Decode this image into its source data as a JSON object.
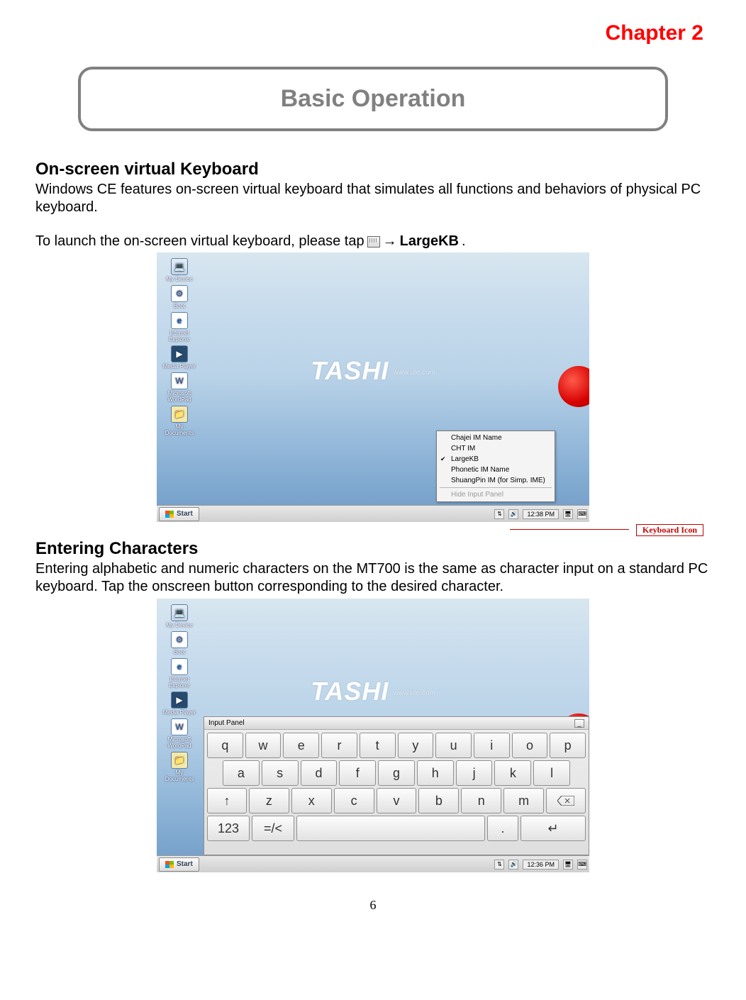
{
  "chapter": "Chapter  2",
  "titleBox": "Basic Operation",
  "section1": {
    "heading": "On-screen virtual Keyboard",
    "para": "Windows CE features on-screen virtual keyboard that simulates all functions and behaviors of physical PC keyboard.",
    "launchPrefix": "To launch the on-screen virtual keyboard, please tap ",
    "arrow": "→",
    "launchTarget": " LargeKB",
    "period": "."
  },
  "callout": "Keyboard Icon",
  "section2": {
    "heading": "Entering Characters",
    "para": "Entering alphabetic and numeric characters on the MT700 is the same as character input on a standard PC keyboard. Tap the onscreen button corresponding to the desired character."
  },
  "desktop": {
    "brand": "TASHI",
    "brandSub": "www.ute.com",
    "icons": [
      {
        "label": "My Device"
      },
      {
        "label": "Boot"
      },
      {
        "label": "Internet Explorer"
      },
      {
        "label": "Media Player"
      },
      {
        "label": "Microsoft WordPad"
      },
      {
        "label": "My Documents"
      }
    ],
    "taskbar": {
      "start": "Start",
      "clock1": "12:38 PM",
      "clock2": "12:36 PM"
    },
    "imeMenu": [
      "Chajei IM Name",
      "CHT IM",
      "LargeKB",
      "Phonetic IM Name",
      "ShuangPin IM (for Simp. IME)",
      "Hide Input Panel"
    ]
  },
  "inputPanel": {
    "title": "Input Panel",
    "rows": {
      "r1": [
        "q",
        "w",
        "e",
        "r",
        "t",
        "y",
        "u",
        "i",
        "o",
        "p"
      ],
      "r2": [
        "a",
        "s",
        "d",
        "f",
        "g",
        "h",
        "j",
        "k",
        "l"
      ],
      "r3_shift": "↑",
      "r3": [
        "z",
        "x",
        "c",
        "v",
        "b",
        "n",
        "m"
      ],
      "r4_123": "123",
      "r4_sym": "=/<",
      "r4_dot": ".",
      "r4_enter": "↵"
    }
  },
  "pageNumber": "6"
}
